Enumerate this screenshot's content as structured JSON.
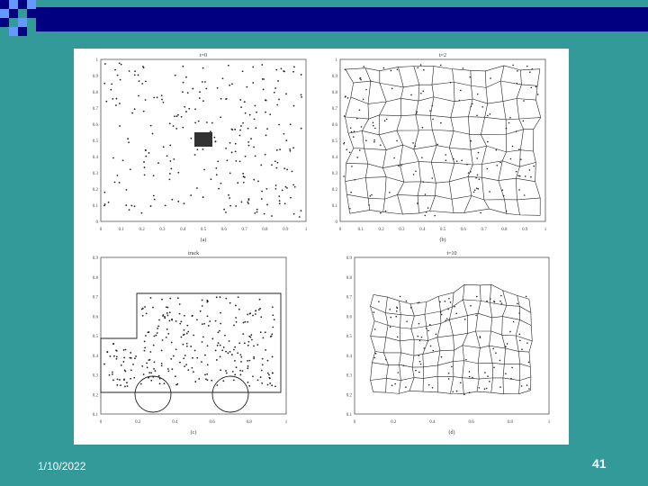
{
  "slide": {
    "date": "1/10/2022",
    "number": "41"
  },
  "figure": {
    "panels": [
      {
        "id": "a",
        "title": "t=0",
        "caption": "(a)",
        "x_ticks": [
          "0",
          "0.1",
          "0.2",
          "0.3",
          "0.4",
          "0.5",
          "0.6",
          "0.7",
          "0.8",
          "0.9",
          "1"
        ],
        "y_ticks": [
          "0",
          "0.1",
          "0.2",
          "0.3",
          "0.4",
          "0.5",
          "0.6",
          "0.7",
          "0.8",
          "0.9",
          "1"
        ]
      },
      {
        "id": "b",
        "title": "t=2",
        "caption": "(b)",
        "x_ticks": [
          "0",
          "0.1",
          "0.2",
          "0.3",
          "0.4",
          "0.5",
          "0.6",
          "0.7",
          "0.8",
          "0.9",
          "1"
        ],
        "y_ticks": [
          "0",
          "0.1",
          "0.2",
          "0.3",
          "0.4",
          "0.5",
          "0.6",
          "0.7",
          "0.8",
          "0.9",
          "1"
        ]
      },
      {
        "id": "c",
        "title": "truck",
        "caption": "(c)",
        "x_ticks": [
          "0",
          "0.2",
          "0.4",
          "0.6",
          "0.8",
          "1"
        ],
        "y_ticks": [
          "0.1",
          "0.2",
          "0.3",
          "0.4",
          "0.5",
          "0.6",
          "0.7",
          "0.8",
          "0.9"
        ]
      },
      {
        "id": "d",
        "title": "t=10",
        "caption": "(d)",
        "x_ticks": [
          "0",
          "0.2",
          "0.4",
          "0.6",
          "0.8",
          "1"
        ],
        "y_ticks": [
          "0.1",
          "0.2",
          "0.3",
          "0.4",
          "0.5",
          "0.6",
          "0.7",
          "0.8",
          "0.9"
        ]
      }
    ]
  },
  "colors": {
    "background": "#339999",
    "top_bar": "#000080",
    "deco_light": "#6699ff"
  }
}
